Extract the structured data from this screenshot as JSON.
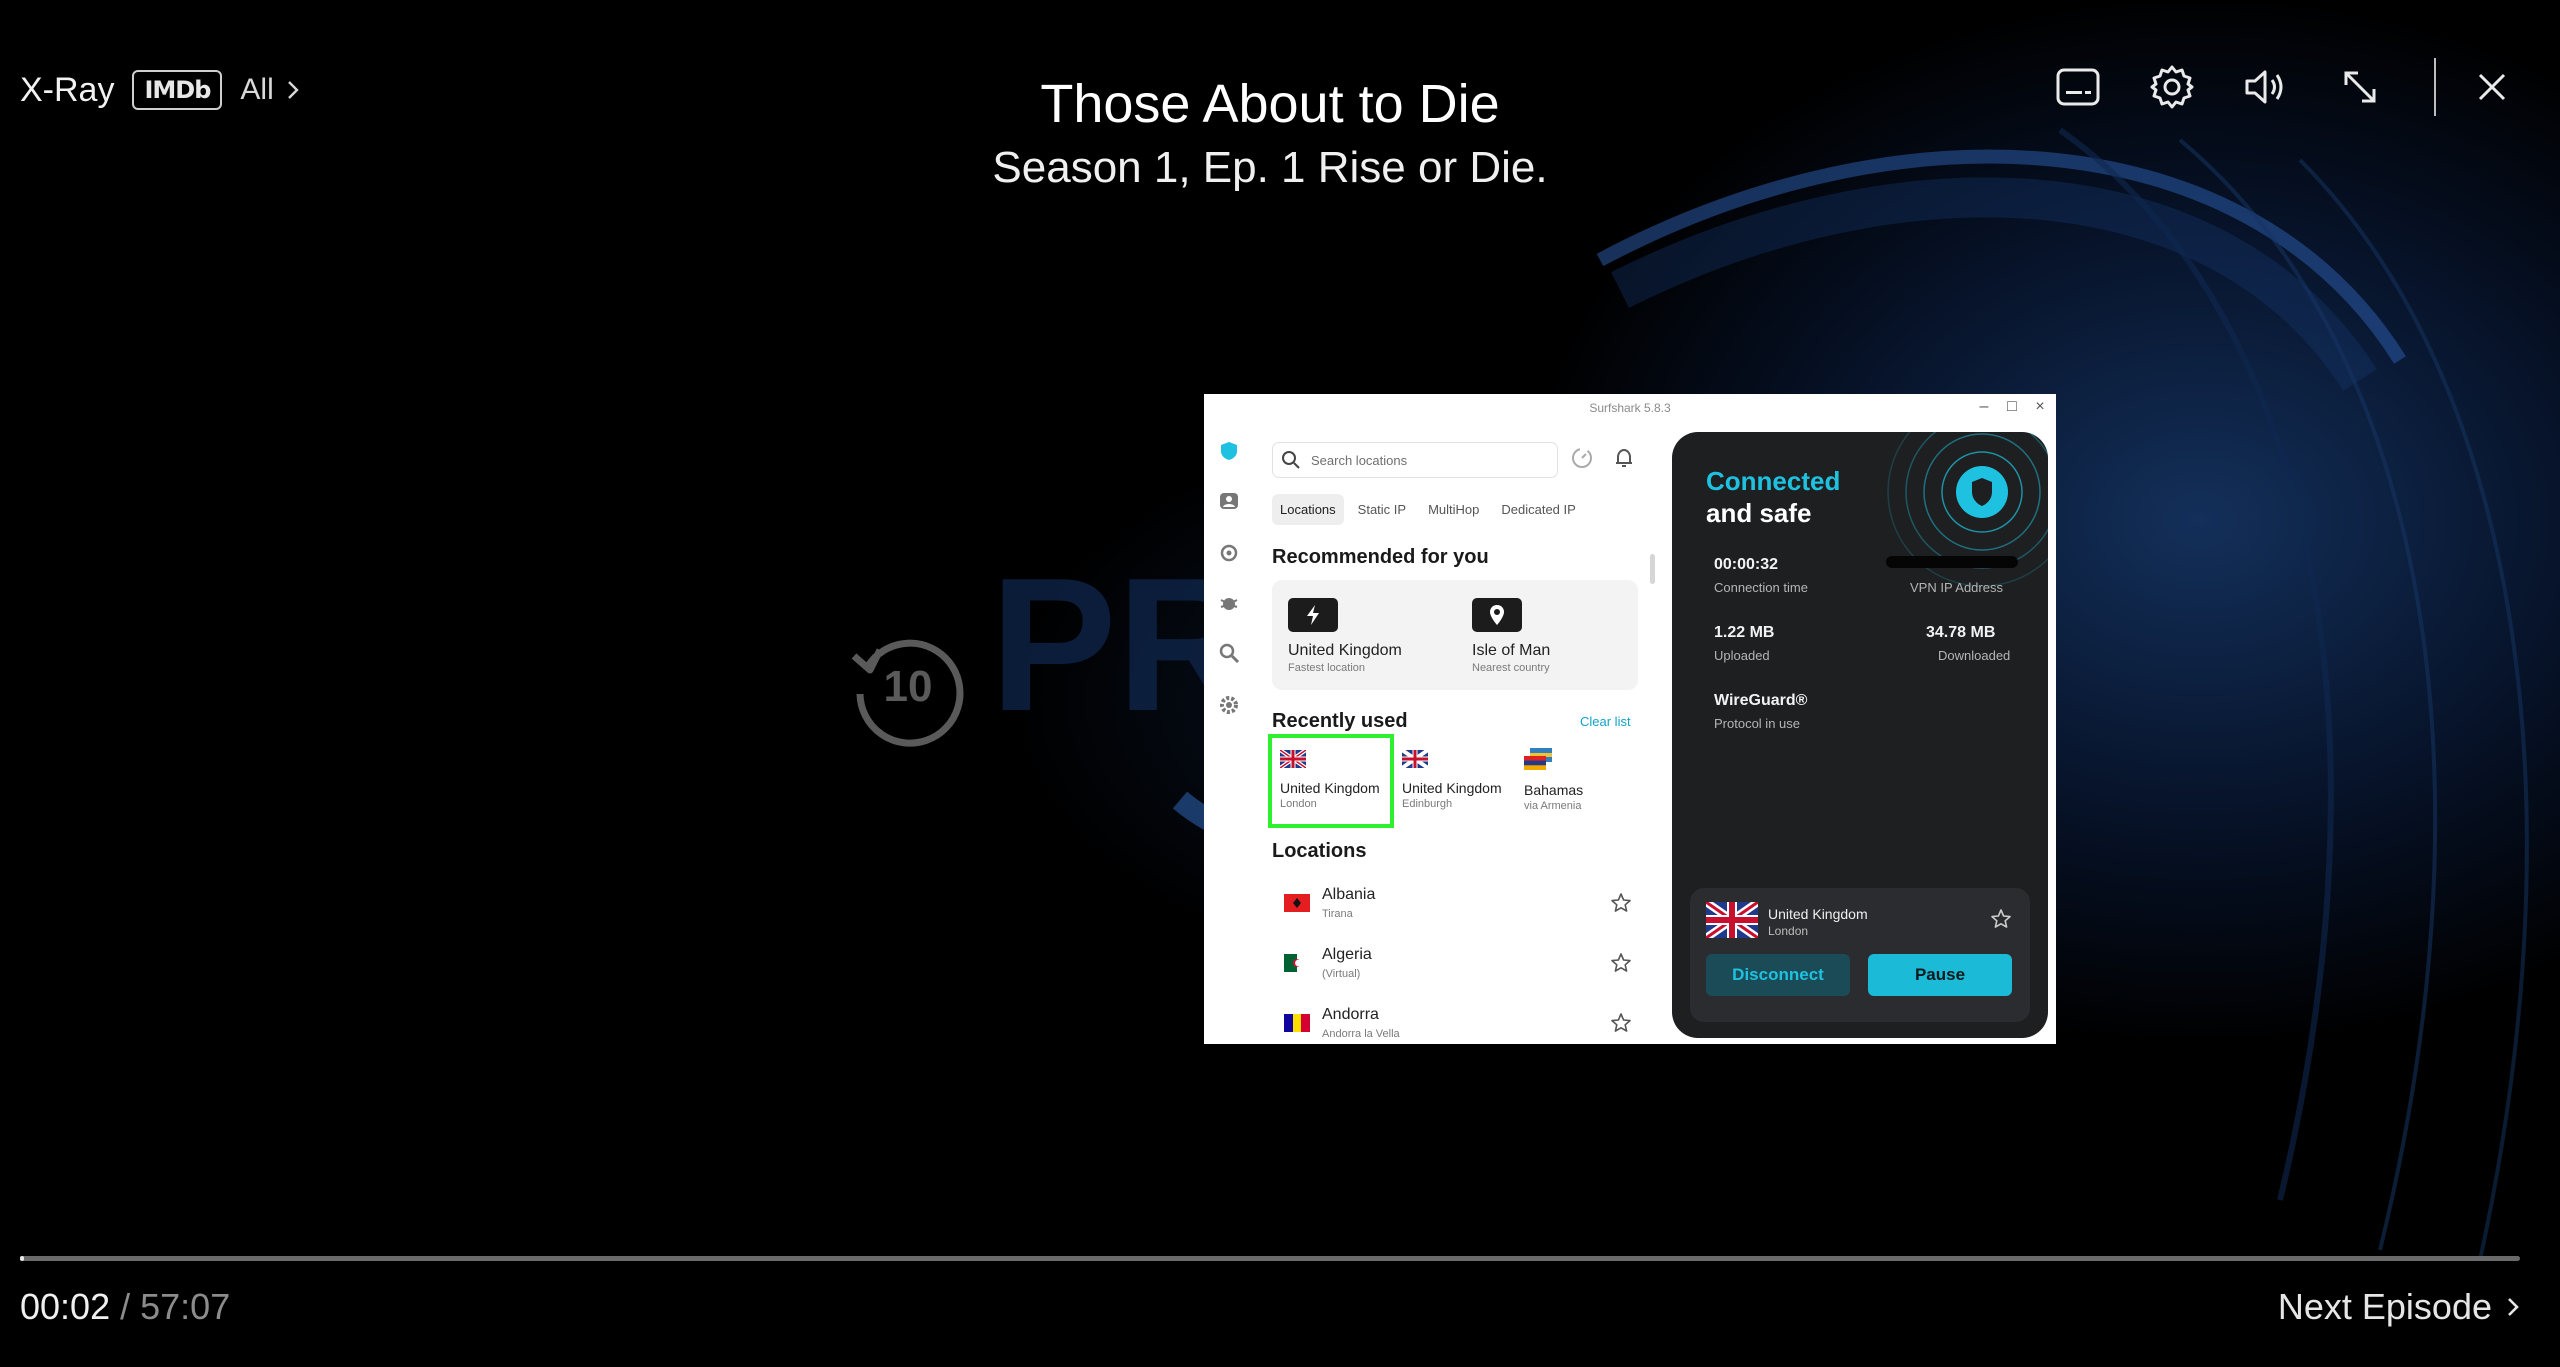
{
  "player": {
    "xray_label": "X-Ray",
    "imdb_badge": "IMDb",
    "all_link": "All",
    "show_title": "Those About to Die",
    "episode_title": "Season 1, Ep. 1 Rise or Die.",
    "rewind_seconds": "10",
    "current_time": "00:02",
    "time_separator": "/",
    "total_time": "57:07",
    "progress_fraction": 0.0006,
    "next_episode": "Next Episode",
    "icons": [
      "subtitles-icon",
      "gear-icon",
      "volume-icon",
      "fullscreen-icon",
      "close-icon"
    ]
  },
  "vpn": {
    "window_title": "Surfshark 5.8.3",
    "search_placeholder": "Search locations",
    "tabs": [
      "Locations",
      "Static IP",
      "MultiHop",
      "Dedicated IP"
    ],
    "recommended_heading": "Recommended for you",
    "recommended": [
      {
        "name": "United Kingdom",
        "sub": "Fastest location",
        "icon": "lightning-icon"
      },
      {
        "name": "Isle of Man",
        "sub": "Nearest country",
        "icon": "pin-icon"
      }
    ],
    "recent_heading": "Recently used",
    "clear_list": "Clear list",
    "recent": [
      {
        "name": "United Kingdom",
        "sub": "London"
      },
      {
        "name": "United Kingdom",
        "sub": "Edinburgh"
      },
      {
        "name": "Bahamas",
        "sub": "via Armenia"
      }
    ],
    "locations_heading": "Locations",
    "locations": [
      {
        "name": "Albania",
        "sub": "Tirana"
      },
      {
        "name": "Algeria",
        "sub": "(Virtual)"
      },
      {
        "name": "Andorra",
        "sub": "Andorra la Vella"
      }
    ],
    "status_line1": "Connected",
    "status_line2": "and safe",
    "connection_time": "00:00:32",
    "connection_time_label": "Connection time",
    "vpn_ip_label": "VPN IP Address",
    "uploaded": "1.22 MB",
    "uploaded_label": "Uploaded",
    "downloaded": "34.78 MB",
    "downloaded_label": "Downloaded",
    "protocol": "WireGuard®",
    "protocol_label": "Protocol in use",
    "connected_country": "United Kingdom",
    "connected_city": "London",
    "disconnect_label": "Disconnect",
    "pause_label": "Pause",
    "colors": {
      "accent": "#1ec2e0",
      "highlight": "#2ef02e",
      "panel": "#1e1f21"
    }
  }
}
